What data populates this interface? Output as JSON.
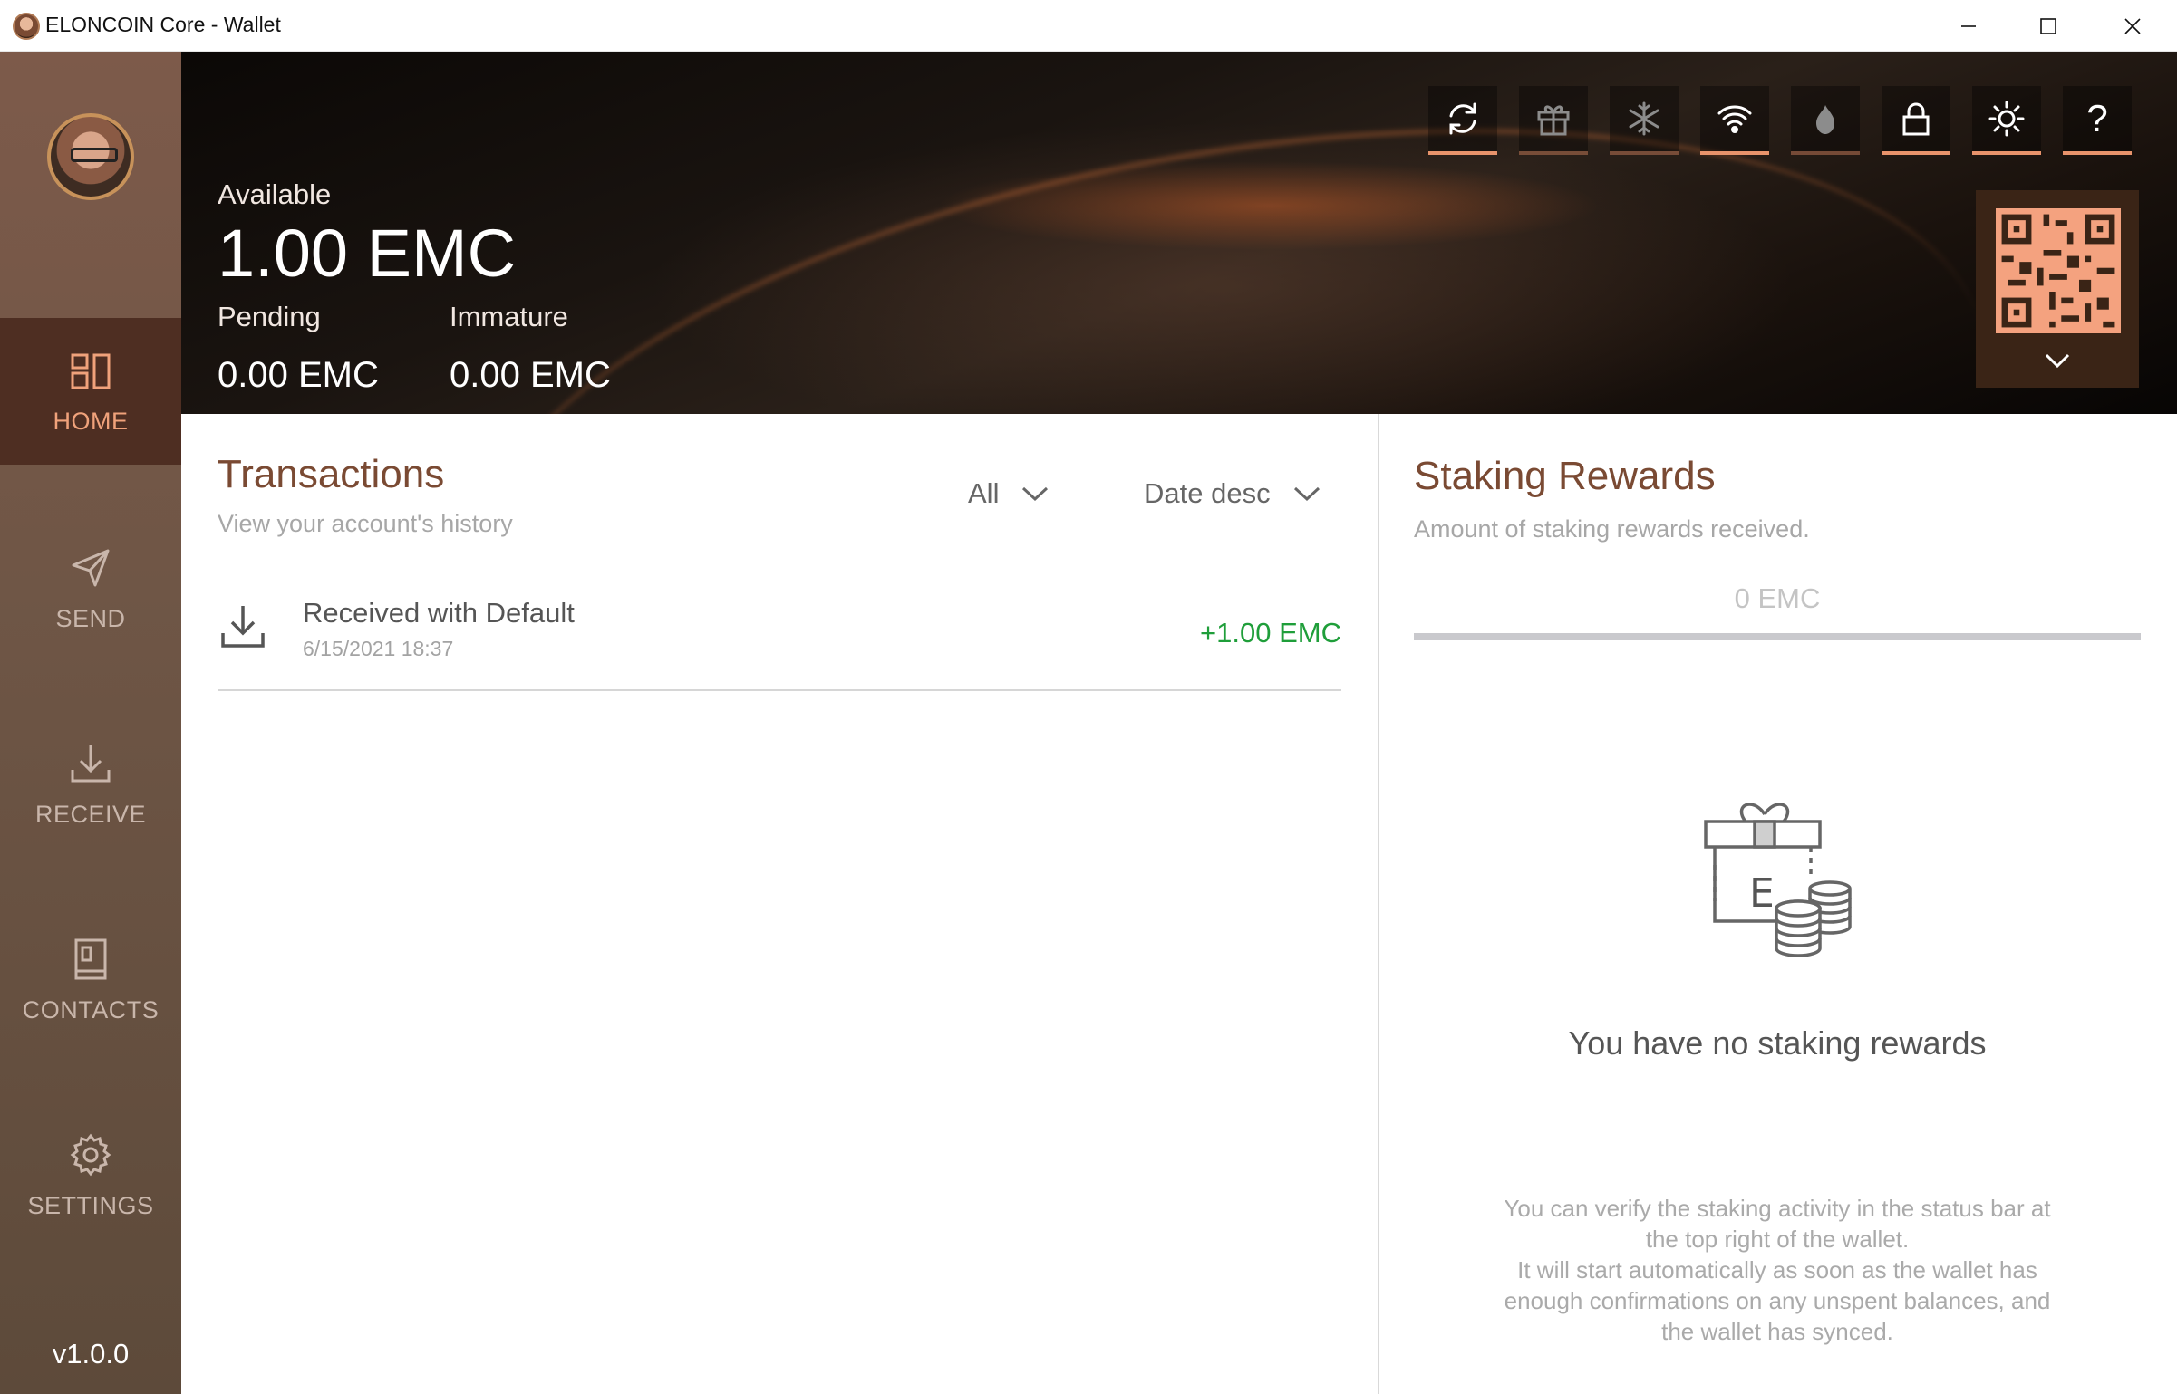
{
  "window": {
    "title": "ELONCOIN Core - Wallet"
  },
  "sidebar": {
    "items": [
      {
        "label": "HOME",
        "icon": "home-icon",
        "active": true
      },
      {
        "label": "SEND",
        "icon": "send-icon"
      },
      {
        "label": "RECEIVE",
        "icon": "receive-icon"
      },
      {
        "label": "CONTACTS",
        "icon": "contacts-icon"
      },
      {
        "label": "SETTINGS",
        "icon": "settings-icon"
      }
    ],
    "version": "v1.0.0"
  },
  "header": {
    "available_label": "Available",
    "available_value": "1.00 EMC",
    "pending_label": "Pending",
    "pending_value": "0.00 EMC",
    "immature_label": "Immature",
    "immature_value": "0.00 EMC",
    "toolbar_icons": [
      "sync-icon",
      "gift-icon",
      "snowflake-icon",
      "wifi-icon",
      "tor-icon",
      "lock-icon",
      "brightness-icon",
      "help-icon"
    ],
    "help_glyph": "?"
  },
  "transactions": {
    "title": "Transactions",
    "subtitle": "View your account's history",
    "filter_type": "All",
    "filter_sort": "Date desc",
    "rows": [
      {
        "label": "Received with Default",
        "date": "6/15/2021 18:37",
        "amount": "+1.00 EMC"
      }
    ]
  },
  "staking": {
    "title": "Staking Rewards",
    "subtitle": "Amount of staking rewards received.",
    "amount": "0 EMC",
    "graphic_letter": "E",
    "empty_text": "You have no staking rewards",
    "note_lines": [
      "You can verify the staking activity in the status bar at",
      "the top right of the wallet.",
      "It will start automatically as soon as the wallet has",
      "enough confirmations on any unspent balances, and",
      "the wallet has synced."
    ]
  },
  "colors": {
    "accent": "#e8936b",
    "brown_title": "#7a4a33",
    "positive": "#1f9e3a"
  }
}
